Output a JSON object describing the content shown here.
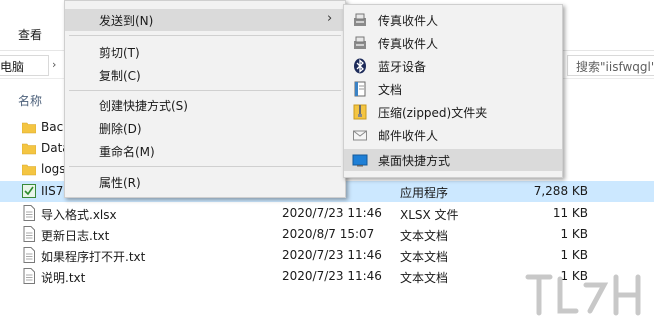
{
  "ribbon": {
    "view_tab": "查看"
  },
  "address": {
    "path_fragment": "此电脑",
    "search_placeholder": "搜索\"iisfwqgl\""
  },
  "columns": {
    "name": "名称"
  },
  "files": [
    {
      "name": "Back",
      "date": "",
      "type": "",
      "size": "",
      "kind": "folder"
    },
    {
      "name": "Data",
      "date": "",
      "type": "",
      "size": "",
      "kind": "folder"
    },
    {
      "name": "logs",
      "date": "",
      "type": "",
      "size": "",
      "kind": "folder"
    },
    {
      "name": "IIS7",
      "date": "11:46",
      "type": "应用程序",
      "size": "7,288 KB",
      "kind": "exe",
      "selected": true
    },
    {
      "name": "导入格式.xlsx",
      "date": "2020/7/23 11:46",
      "type": "XLSX 文件",
      "size": "11 KB",
      "kind": "file"
    },
    {
      "name": "更新日志.txt",
      "date": "2020/8/7 15:07",
      "type": "文本文档",
      "size": "1 KB",
      "kind": "file"
    },
    {
      "name": "如果程序打不开.txt",
      "date": "2020/7/23 11:46",
      "type": "文本文档",
      "size": "1 KB",
      "kind": "file"
    },
    {
      "name": "说明.txt",
      "date": "2020/7/23 11:46",
      "type": "文本文档",
      "size": "1 KB",
      "kind": "file"
    }
  ],
  "context_menu": {
    "send_to": "发送到(N)",
    "cut": "剪切(T)",
    "copy": "复制(C)",
    "create_shortcut": "创建快捷方式(S)",
    "delete": "删除(D)",
    "rename": "重命名(M)",
    "properties": "属性(R)"
  },
  "send_to_menu": {
    "fax1": "传真收件人",
    "fax2": "传真收件人",
    "bluetooth": "蓝牙设备",
    "documents": "文档",
    "zip": "压缩(zipped)文件夹",
    "mail": "邮件收件人",
    "desktop": "桌面快捷方式"
  },
  "colors": {
    "selection": "#cce8ff",
    "menu_bg": "#f2f2f2",
    "menu_highlight": "#dadada",
    "folder": "#f4c542"
  }
}
